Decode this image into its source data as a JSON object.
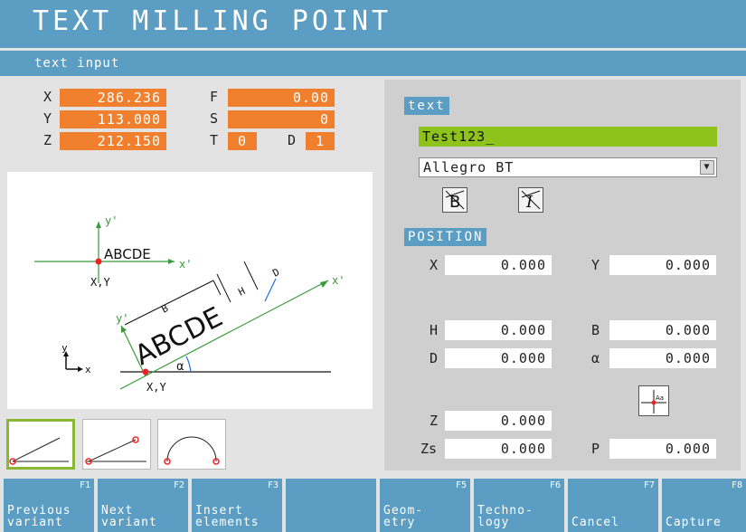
{
  "header": {
    "title": "TEXT MILLING POINT",
    "subtitle": "text input"
  },
  "coords": {
    "x_label": "X",
    "x_value": "286.236",
    "y_label": "Y",
    "y_value": "113.000",
    "z_label": "Z",
    "z_value": "212.150",
    "f_label": "F",
    "f_value": "0.00",
    "s_label": "S",
    "s_value": "0",
    "t_label": "T",
    "t_value": "0",
    "d_label": "D",
    "d_value": "1"
  },
  "drawing": {
    "top_text": "ABCDE",
    "top_y_axis": "y'",
    "top_x_axis": "x'",
    "top_origin": "X,Y",
    "rot_text": "ABCDE",
    "rot_y_axis": "y'",
    "rot_x_axis": "x'",
    "dim_b": "B",
    "dim_h": "H",
    "dim_d": "D",
    "angle": "α",
    "rot_origin": "X,Y",
    "axes_y": "y",
    "axes_x": "x"
  },
  "form": {
    "text_section": "text",
    "text_value": "Test123_",
    "font_value": "Allegro BT",
    "position_section": "POSITION",
    "x_label": "X",
    "x_value": "0.000",
    "y_label": "Y",
    "y_value": "0.000",
    "h_label": "H",
    "h_value": "0.000",
    "b_label": "B",
    "b_value": "0.000",
    "d_label": "D",
    "d_value": "0.000",
    "alpha_label": "α",
    "alpha_value": "0.000",
    "z_label": "Z",
    "z_value": "0.000",
    "zs_label": "Zs",
    "zs_value": "0.000",
    "p_label": "P",
    "p_value": "0.000",
    "text_pos_icon_text": "Aa"
  },
  "fkeys": [
    {
      "num": "F1",
      "label": "Previous\nvariant"
    },
    {
      "num": "F2",
      "label": "Next\nvariant"
    },
    {
      "num": "F3",
      "label": "Insert\nelements"
    },
    {
      "num": "",
      "label": ""
    },
    {
      "num": "F5",
      "label": "Geom-\netry"
    },
    {
      "num": "F6",
      "label": "Techno-\nlogy"
    },
    {
      "num": "F7",
      "label": "Cancel"
    },
    {
      "num": "F8",
      "label": "Capture"
    }
  ],
  "colors": {
    "accent_blue": "#5b9dc3",
    "orange": "#f07f2e",
    "green": "#8ec31d",
    "selected_border": "#8ab832"
  }
}
